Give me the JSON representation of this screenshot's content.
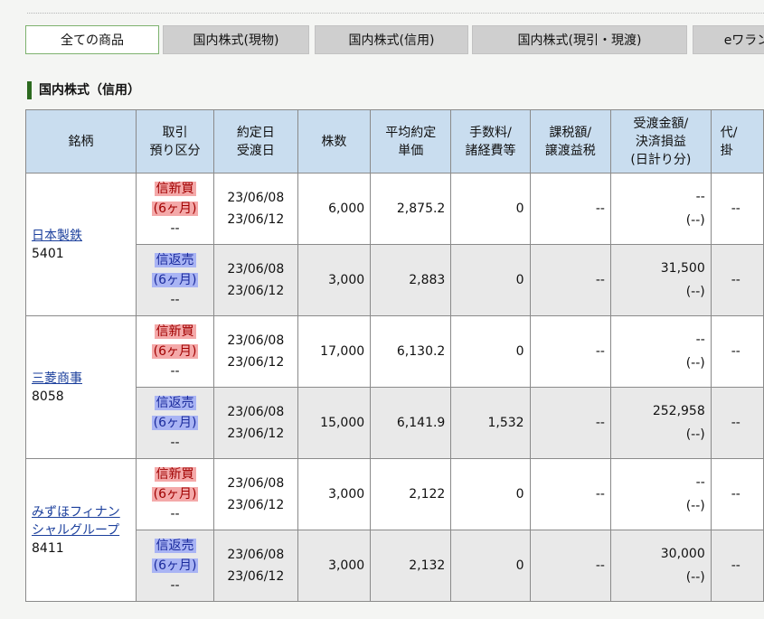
{
  "tabs": [
    {
      "label": "全ての商品",
      "active": true
    },
    {
      "label": "国内株式(現物)",
      "active": false
    },
    {
      "label": "国内株式(信用)",
      "active": false
    },
    {
      "label": "国内株式(現引・現渡)",
      "active": false
    },
    {
      "label": "eワラン",
      "active": false
    }
  ],
  "section_title": "国内株式（信用）",
  "columns": [
    "銘柄",
    "取引\n預り区分",
    "約定日\n受渡日",
    "株数",
    "平均約定\n単価",
    "手数料/\n諸経費等",
    "課税額/\n譲渡益税",
    "受渡金額/\n決済損益\n(日計り分)",
    "代/\n掛"
  ],
  "stocks": [
    {
      "name": "日本製鉄",
      "code": "5401",
      "rows": [
        {
          "type": "信新買",
          "term": "(6ヶ月)",
          "sub": "--",
          "trade_date": "23/06/08",
          "settle_date": "23/06/12",
          "shares": "6,000",
          "price": "2,875.2",
          "fee": "0",
          "tax": "--",
          "amount": "--",
          "pl": "(--)",
          "extra": "--",
          "style": "red"
        },
        {
          "type": "信返売",
          "term": "(6ヶ月)",
          "sub": "--",
          "trade_date": "23/06/08",
          "settle_date": "23/06/12",
          "shares": "3,000",
          "price": "2,883",
          "fee": "0",
          "tax": "--",
          "amount": "31,500",
          "pl": "(--)",
          "extra": "--",
          "style": "blue"
        }
      ]
    },
    {
      "name": "三菱商事",
      "code": "8058",
      "rows": [
        {
          "type": "信新買",
          "term": "(6ヶ月)",
          "sub": "--",
          "trade_date": "23/06/08",
          "settle_date": "23/06/12",
          "shares": "17,000",
          "price": "6,130.2",
          "fee": "0",
          "tax": "--",
          "amount": "--",
          "pl": "(--)",
          "extra": "--",
          "style": "red"
        },
        {
          "type": "信返売",
          "term": "(6ヶ月)",
          "sub": "--",
          "trade_date": "23/06/08",
          "settle_date": "23/06/12",
          "shares": "15,000",
          "price": "6,141.9",
          "fee": "1,532",
          "tax": "--",
          "amount": "252,958",
          "pl": "(--)",
          "extra": "--",
          "style": "blue"
        }
      ]
    },
    {
      "name": "みずほフィナンシャルグループ",
      "code": "8411",
      "rows": [
        {
          "type": "信新買",
          "term": "(6ヶ月)",
          "sub": "--",
          "trade_date": "23/06/08",
          "settle_date": "23/06/12",
          "shares": "3,000",
          "price": "2,122",
          "fee": "0",
          "tax": "--",
          "amount": "--",
          "pl": "(--)",
          "extra": "--",
          "style": "red"
        },
        {
          "type": "信返売",
          "term": "(6ヶ月)",
          "sub": "--",
          "trade_date": "23/06/08",
          "settle_date": "23/06/12",
          "shares": "3,000",
          "price": "2,132",
          "fee": "0",
          "tax": "--",
          "amount": "30,000",
          "pl": "(--)",
          "extra": "--",
          "style": "blue"
        }
      ]
    }
  ]
}
